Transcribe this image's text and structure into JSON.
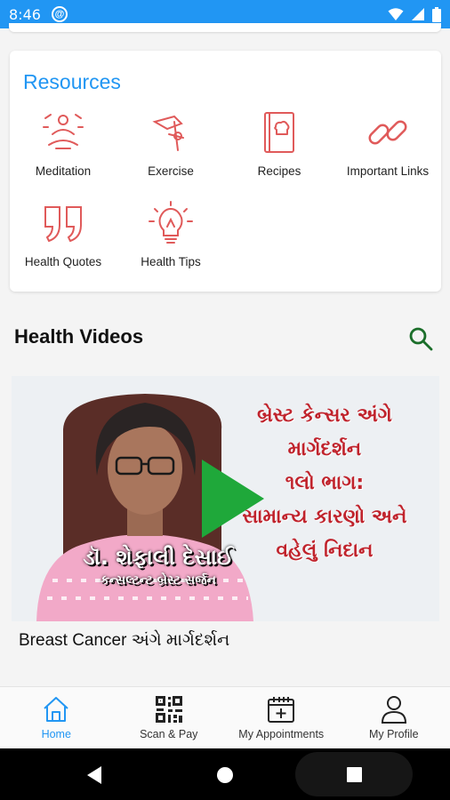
{
  "status_bar": {
    "time": "8:46",
    "app_icon": "at-icon",
    "icons": [
      "wifi-icon",
      "signal-icon",
      "battery-icon"
    ]
  },
  "resources": {
    "title": "Resources",
    "items": [
      {
        "label": "Meditation",
        "icon": "meditation-icon"
      },
      {
        "label": "Exercise",
        "icon": "exercise-icon"
      },
      {
        "label": "Recipes",
        "icon": "recipe-book-icon"
      },
      {
        "label": "Important Links",
        "icon": "link-icon"
      },
      {
        "label": "Health Quotes",
        "icon": "quote-icon"
      },
      {
        "label": "Health Tips",
        "icon": "lightbulb-icon"
      }
    ]
  },
  "videos": {
    "header": "Health Videos",
    "search_icon": "search-icon",
    "items": [
      {
        "title": "Breast Cancer અંગે માર્ગદર્શન",
        "thumbnail_text": [
          "બ્રેસ્ટ કેન્સર અંગે",
          "માર્ગદર્શન",
          "૧લો ભાગ:",
          "સામાન્ય કારણો અને",
          "વહેલું નિદાન"
        ],
        "doctor_name": "ડૉ. શેફાલી દેસાઈ",
        "doctor_role": "કન્સલ્ટન્ટ બ્રેસ્ટ સર્જન"
      }
    ]
  },
  "bottom_nav": {
    "items": [
      {
        "label": "Home",
        "icon": "home-icon",
        "active": true
      },
      {
        "label": "Scan & Pay",
        "icon": "qr-code-icon",
        "active": false
      },
      {
        "label": "My Appointments",
        "icon": "calendar-icon",
        "active": false
      },
      {
        "label": "My Profile",
        "icon": "person-icon",
        "active": false
      }
    ]
  },
  "colors": {
    "accent": "#2196f3",
    "icon_red": "#e05a5a",
    "search_green": "#1b6e2a",
    "play_green": "#1fa83a"
  }
}
